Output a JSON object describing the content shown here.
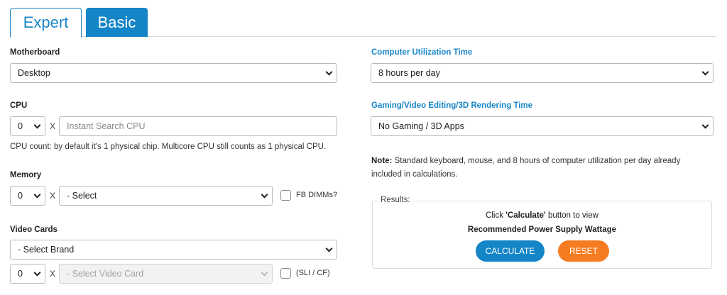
{
  "tabs": {
    "expert": "Expert",
    "basic": "Basic"
  },
  "motherboard": {
    "label": "Motherboard",
    "value": "Desktop"
  },
  "cpu": {
    "label": "CPU",
    "count": "0",
    "x": "X",
    "search_placeholder": "Instant Search CPU",
    "hint": "CPU count: by default it's 1 physical chip. Multicore CPU still counts as 1 physical CPU."
  },
  "memory": {
    "label": "Memory",
    "count": "0",
    "x": "X",
    "select_value": "- Select",
    "fb_dimms_label": "FB DIMMs?"
  },
  "video_cards": {
    "label": "Video Cards",
    "brand_value": "- Select Brand",
    "count": "0",
    "x": "X",
    "card_value": "- Select Video Card",
    "sli_label": "(SLI / CF)"
  },
  "utilization": {
    "label": "Computer Utilization Time",
    "value": "8 hours per day"
  },
  "gaming": {
    "label": "Gaming/Video Editing/3D Rendering Time",
    "value": "No Gaming / 3D Apps"
  },
  "note": {
    "bold": "Note:",
    "text": " Standard keyboard, mouse, and 8 hours of computer utilization per day already included in calculations."
  },
  "results": {
    "legend": "Results:",
    "line1_pre": "Click ",
    "line1_bold": "'Calculate'",
    "line1_post": " button to view",
    "line2": "Recommended Power Supply Wattage",
    "calculate": "CALCULATE",
    "reset": "RESET"
  },
  "colors": {
    "accent": "#1485c7",
    "reset": "#f57c20"
  }
}
